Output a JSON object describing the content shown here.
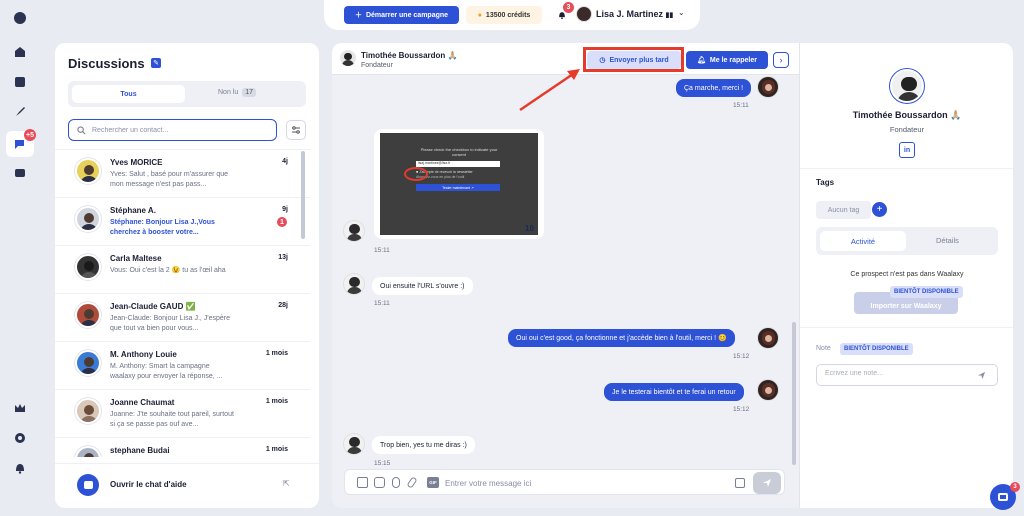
{
  "rail": {
    "badge": "+5",
    "icons": [
      "logo-icon",
      "home-icon",
      "contacts-icon",
      "rocket-icon",
      "messages-icon",
      "inbox-icon",
      "crown-icon",
      "gear-icon",
      "bell-icon"
    ]
  },
  "topbar": {
    "campaign_label": "Démarrer une campagne",
    "credits_label": "13500 crédits",
    "notif_count": "3",
    "user_name": "Lisa J. Martinez",
    "user_flag": "▮▮"
  },
  "discussions": {
    "title": "Discussions",
    "tab_all": "Tous",
    "tab_unread": "Non lu",
    "unread_count": "17",
    "search_placeholder": "Rechercher un contact...",
    "items": [
      {
        "name": "Yves MORICE",
        "time": "4j",
        "preview": "Yves: Salut , basé pour m'assurer que mon message n'est pas pass...",
        "highlight": false
      },
      {
        "name": "Stéphane A.",
        "time": "9j",
        "preview": "Stéphane: Bonjour Lisa J.,Vous cherchez à booster votre...",
        "highlight": true,
        "unread": "1"
      },
      {
        "name": "Carla Maltese",
        "time": "13j",
        "preview": "Vous: Oui c'est la 2 😉 tu as l'œil aha",
        "highlight": false
      },
      {
        "name": "Jean-Claude GAUD ✅",
        "time": "28j",
        "preview": "Jean-Claude: Bonjour Lisa J., J'espère que tout va bien pour vous...",
        "highlight": false
      },
      {
        "name": "M. Anthony Louie",
        "time": "1 mois",
        "preview": "M. Anthony: Smart la campagne waalaxy pour envoyer la réponse, ...",
        "highlight": false
      },
      {
        "name": "Joanne Chaumat",
        "time": "1 mois",
        "preview": "Joanne: J'te souhaite tout pareil, surtout si ça se passe pas ouf ave...",
        "highlight": false
      },
      {
        "name": "stephane Budai",
        "time": "1 mois",
        "preview": "",
        "highlight": false
      }
    ],
    "help_label": "Ouvrir le chat d'aide"
  },
  "chat": {
    "contact_name": "Timothée Boussardon 🙏🏼",
    "contact_role": "Fondateur",
    "later_label": "Envoyer plus tard",
    "remind_label": "Me le rappeler",
    "next_label": "›",
    "messages": [
      {
        "text": "Ça marche, merci !",
        "time": "15:11"
      },
      {
        "time": "15:11"
      },
      {
        "text": "Oui ensuite l'URL s'ouvre :)",
        "time": "15:11"
      },
      {
        "text": "Oui oui c'est good, ça fonctionne et j'accède bien à l'outil, merci ! 😊",
        "time": "15:12"
      },
      {
        "text": "Je le testerai bientôt et te ferai un retour",
        "time": "15:12"
      },
      {
        "text": "Trop bien, yes tu me diras :)",
        "time": "15:15"
      }
    ],
    "screenshot": {
      "line1": "Please check the checkbox to indicate your",
      "line2": "consent",
      "input_value": "lisaj.martinez@lisa.fr",
      "check_label": "J'accepte de recevoir la newsletter",
      "check2_label": "Abonnez-vous en plus de l'outil",
      "button_label": "Tester maintenant ↗",
      "page_number": "10"
    },
    "composer_placeholder": "Entrer votre message ici",
    "gif_label": "GIF"
  },
  "profile": {
    "name": "Timothée Boussardon 🙏🏼",
    "role": "Fondateur",
    "linkedin": "in",
    "tags_title": "Tags",
    "no_tag": "Aucun tag",
    "add_tag": "+",
    "tab_activity": "Activité",
    "tab_details": "Détails",
    "not_in_waalaxy": "Ce prospect n'est pas dans Waalaxy",
    "soon_badge": "BIENTÔT DISPONIBLE",
    "import_label": "Importer sur Waalaxy",
    "note_label": "Note",
    "note_placeholder": "Écrivez une note..."
  },
  "help_fab": {
    "badge": "3"
  },
  "colors": {
    "accent": "#2e52d6",
    "highlight_box": "#e53b2a",
    "badge": "#e74c5a"
  }
}
